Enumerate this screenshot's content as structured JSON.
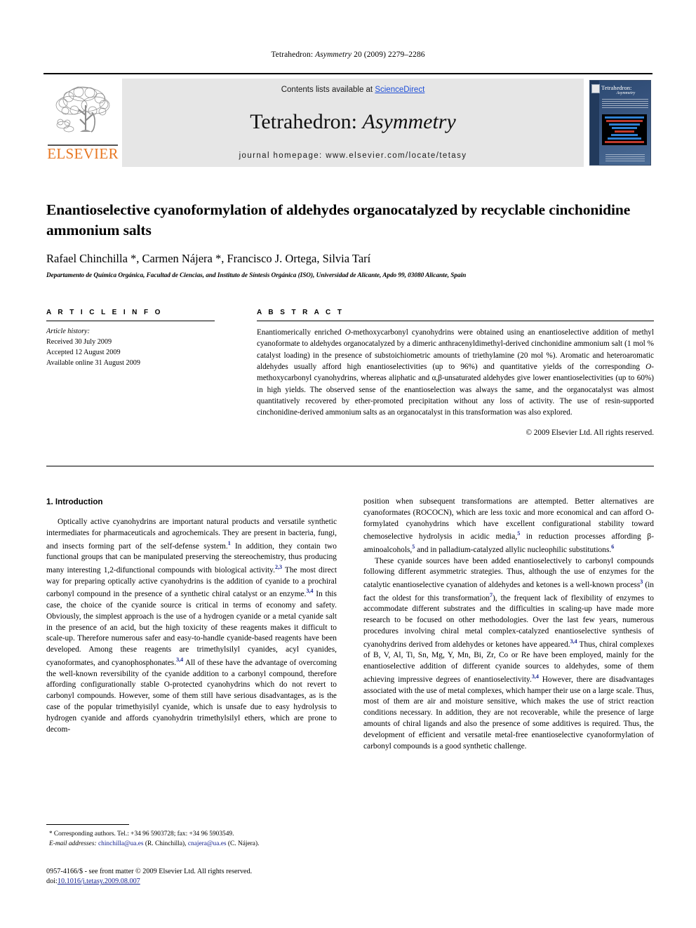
{
  "running_head": {
    "journal": "Tetrahedron:",
    "journal_italic": "Asymmetry",
    "citation": "20 (2009) 2279–2286"
  },
  "masthead": {
    "publisher": "ELSEVIER",
    "contents_prefix": "Contents lists available at ",
    "contents_link": "ScienceDirect",
    "journal_title_main": "Tetrahedron: ",
    "journal_title_italic": "Asymmetry",
    "homepage": "journal homepage: www.elsevier.com/locate/tetasy",
    "cover_title": "Tetrahedron:",
    "cover_subtitle": "Asymmetry",
    "link_color": "#1f4fd8",
    "elsevier_orange": "#E87722",
    "band_gray": "#e6e6e6"
  },
  "article": {
    "title": "Enantioselective cyanoformylation of aldehydes organocatalyzed by recyclable cinchonidine ammonium salts",
    "authors": "Rafael Chinchilla *, Carmen Nájera *, Francisco J. Ortega, Silvia Tarí",
    "affiliation": "Departamento de Química Orgánica, Facultad de Ciencias, and Instituto de Síntesis Orgánica (ISO), Universidad de Alicante, Apdo 99, 03080 Alicante, Spain"
  },
  "info": {
    "heading": "A R T I C L E    I N F O",
    "history_label": "Article history:",
    "received": "Received 30 July 2009",
    "accepted": "Accepted 12 August 2009",
    "available": "Available online 31 August 2009"
  },
  "abstract": {
    "heading": "A B S T R A C T",
    "text_part1": "Enantiomerically enriched ",
    "italic1": "O",
    "text_part2": "-methoxycarbonyl cyanohydrins were obtained using an enantioselective addition of methyl cyanoformate to aldehydes organocatalyzed by a dimeric anthracenyldimethyl-derived cinchonidine ammonium salt (1 mol % catalyst loading) in the presence of substoichiometric amounts of triethylamine (20 mol %). Aromatic and heteroaromatic aldehydes usually afford high enantioselectivities (up to 96%) and quantitative yields of the corresponding ",
    "italic2": "O",
    "text_part3": "-methoxycarbonyl cyanohydrins, whereas aliphatic and α,β-unsaturated aldehydes give lower enantioselectivities (up to 60%) in high yields. The observed sense of the enantioselection was always the same, and the organocatalyst was almost quantitatively recovered by ether-promoted precipitation without any loss of activity. The use of resin-supported cinchonidine-derived ammonium salts as an organocatalyst in this transformation was also explored.",
    "copyright": "© 2009 Elsevier Ltd. All rights reserved."
  },
  "body": {
    "section_title": "1. Introduction",
    "left_paragraph_1": "Optically active cyanohydrins are important natural products and versatile synthetic intermediates for pharmaceuticals and agrochemicals. They are present in bacteria, fungi, and insects forming part of the self-defense system.",
    "ref_1": "1",
    "left_paragraph_1b": " In addition, they contain two functional groups that can be manipulated preserving the stereochemistry, thus producing many interesting 1,2-difunctional compounds with biological activity.",
    "ref_2": "2,3",
    "left_paragraph_1c": " The most direct way for preparing optically active cyanohydrins is the addition of cyanide to a prochiral carbonyl compound in the presence of a synthetic chiral catalyst or an enzyme.",
    "ref_3": "3,4",
    "left_paragraph_1d": " In this case, the choice of the cyanide source is critical in terms of economy and safety. Obviously, the simplest approach is the use of a hydrogen cyanide or a metal cyanide salt in the presence of an acid, but the high toxicity of these reagents makes it difficult to scale-up. Therefore numerous safer and easy-to-handle cyanide-based reagents have been developed. Among these reagents are trimethylsilyl cyanides, acyl cyanides, cyanoformates, and cyanophosphonates.",
    "ref_4": "3,4",
    "left_paragraph_1e": " All of these have the advantage of overcoming the well-known reversibility of the cyanide addition to a carbonyl compound, therefore affording configurationally stable O-protected cyanohydrins which do not revert to carbonyl compounds. However, some of them still have serious disadvantages, as is the case of the popular trimethyisilyl cyanide, which is unsafe due to easy hydrolysis to hydrogen cyanide and affords cyanohydrin trimethylsilyl ethers, which are prone to decom-",
    "right_paragraph_1": "position when subsequent transformations are attempted. Better alternatives are cyanoformates (ROCOCN), which are less toxic and more economical and can afford O-formylated cyanohydrins which have excellent configurational stability toward chemoselective hydrolysis in acidic media,",
    "ref_5": "5",
    "right_paragraph_1b": " in reduction processes affording β-aminoalcohols,",
    "ref_6": "5",
    "right_paragraph_1c": " and in palladium-catalyzed allylic nucleophilic substitutions.",
    "ref_7": "6",
    "right_paragraph_2": "These cyanide sources have been added enantioselectively to carbonyl compounds following different asymmetric strategies. Thus, although the use of enzymes for the catalytic enantioselective cyanation of aldehydes and ketones is a well-known process",
    "ref_8": "3",
    "right_paragraph_2b": " (in fact the oldest for this transformation",
    "ref_9": "7",
    "right_paragraph_2c": "), the frequent lack of flexibility of enzymes to accommodate different substrates and the difficulties in scaling-up have made more research to be focused on other methodologies. Over the last few years, numerous procedures involving chiral metal complex-catalyzed enantioselective synthesis of cyanohydrins derived from aldehydes or ketones have appeared.",
    "ref_10": "3,4",
    "right_paragraph_2d": " Thus, chiral complexes of B, V, Al, Ti, Sn, Mg, Y, Mn, Bi, Zr, Co or Re have been employed, mainly for the enantioselective addition of different cyanide sources to aldehydes, some of them achieving impressive degrees of enantioselectivity.",
    "ref_11": "3,4",
    "right_paragraph_2e": " However, there are disadvantages associated with the use of metal complexes, which hamper their use on a large scale. Thus, most of them are air and moisture sensitive, which makes the use of strict reaction conditions necessary. In addition, they are not recoverable, while the presence of large amounts of chiral ligands and also the presence of some additives is required. Thus, the development of efficient and versatile metal-free enantioselective cyanoformylation of carbonyl compounds is a good synthetic challenge."
  },
  "footnote": {
    "marker": "*",
    "corresponding": "Corresponding authors. Tel.: +34 96 5903728; fax: +34 96 5903549.",
    "email_label": "E-mail addresses:",
    "email1": "chinchilla@ua.es",
    "email1_name": " (R. Chinchilla), ",
    "email2": "cnajera@ua.es",
    "email2_name": " (C. Nájera)."
  },
  "footer": {
    "issn_line": "0957-4166/$ - see front matter © 2009 Elsevier Ltd. All rights reserved.",
    "doi_label": "doi:",
    "doi_value": "10.1016/j.tetasy.2009.08.007"
  }
}
